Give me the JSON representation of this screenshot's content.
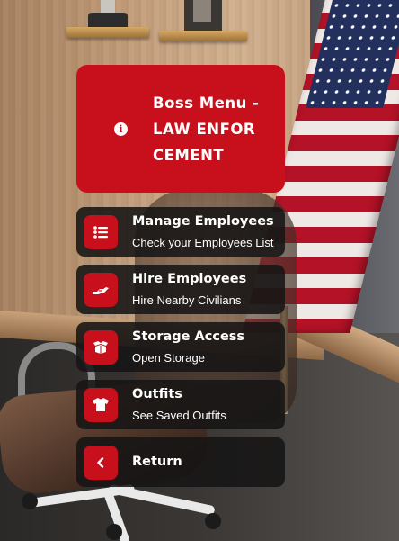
{
  "menu": {
    "header": {
      "icon": "info-icon",
      "title": "Boss Menu - LAW ENFORCEMENT"
    },
    "items": [
      {
        "icon": "list-icon",
        "title": "Manage Employees",
        "subtitle": "Check your Employees List"
      },
      {
        "icon": "handshake-icon",
        "title": "Hire Employees",
        "subtitle": "Hire Nearby Civilians"
      },
      {
        "icon": "box-open-icon",
        "title": "Storage Access",
        "subtitle": "Open Storage"
      },
      {
        "icon": "shirt-icon",
        "title": "Outfits",
        "subtitle": "See Saved Outfits"
      },
      {
        "icon": "chevron-left-icon",
        "title": "Return",
        "subtitle": ""
      }
    ]
  },
  "colors": {
    "accent": "#c8101c",
    "item_background": "#161414"
  }
}
